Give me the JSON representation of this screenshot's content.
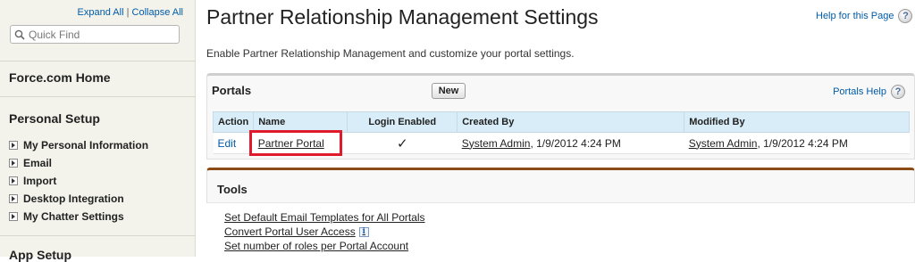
{
  "sidebar": {
    "expand_all": "Expand All",
    "separator": "|",
    "collapse_all": "Collapse All",
    "quick_find_placeholder": "Quick Find",
    "force_home": "Force.com Home",
    "personal_setup": "Personal Setup",
    "items": [
      {
        "label": "My Personal Information"
      },
      {
        "label": "Email"
      },
      {
        "label": "Import"
      },
      {
        "label": "Desktop Integration"
      },
      {
        "label": "My Chatter Settings"
      }
    ],
    "app_setup": "App Setup"
  },
  "header": {
    "title": "Partner Relationship Management Settings",
    "help_link": "Help for this Page",
    "description": "Enable Partner Relationship Management and customize your portal settings."
  },
  "portals": {
    "title": "Portals",
    "new_button": "New",
    "help_link": "Portals Help",
    "columns": [
      "Action",
      "Name",
      "Login Enabled",
      "Created By",
      "Modified By"
    ],
    "rows": [
      {
        "action": "Edit",
        "name": "Partner Portal",
        "login_enabled": "✓",
        "created_by_user": "System Admin",
        "created_by_date": ", 1/9/2012 4:24 PM",
        "modified_by_user": "System Admin",
        "modified_by_date": ", 1/9/2012 4:24 PM"
      }
    ]
  },
  "tools": {
    "title": "Tools",
    "links": [
      {
        "label": "Set Default Email Templates for All Portals"
      },
      {
        "label": "Convert Portal User Access",
        "info": "i"
      },
      {
        "label": "Set number of roles per Portal Account"
      }
    ]
  },
  "colors": {
    "link": "#015ba7",
    "table_header_bg": "#d8edf7",
    "highlight": "#e01a2a",
    "tools_accent": "#8a4b17"
  }
}
